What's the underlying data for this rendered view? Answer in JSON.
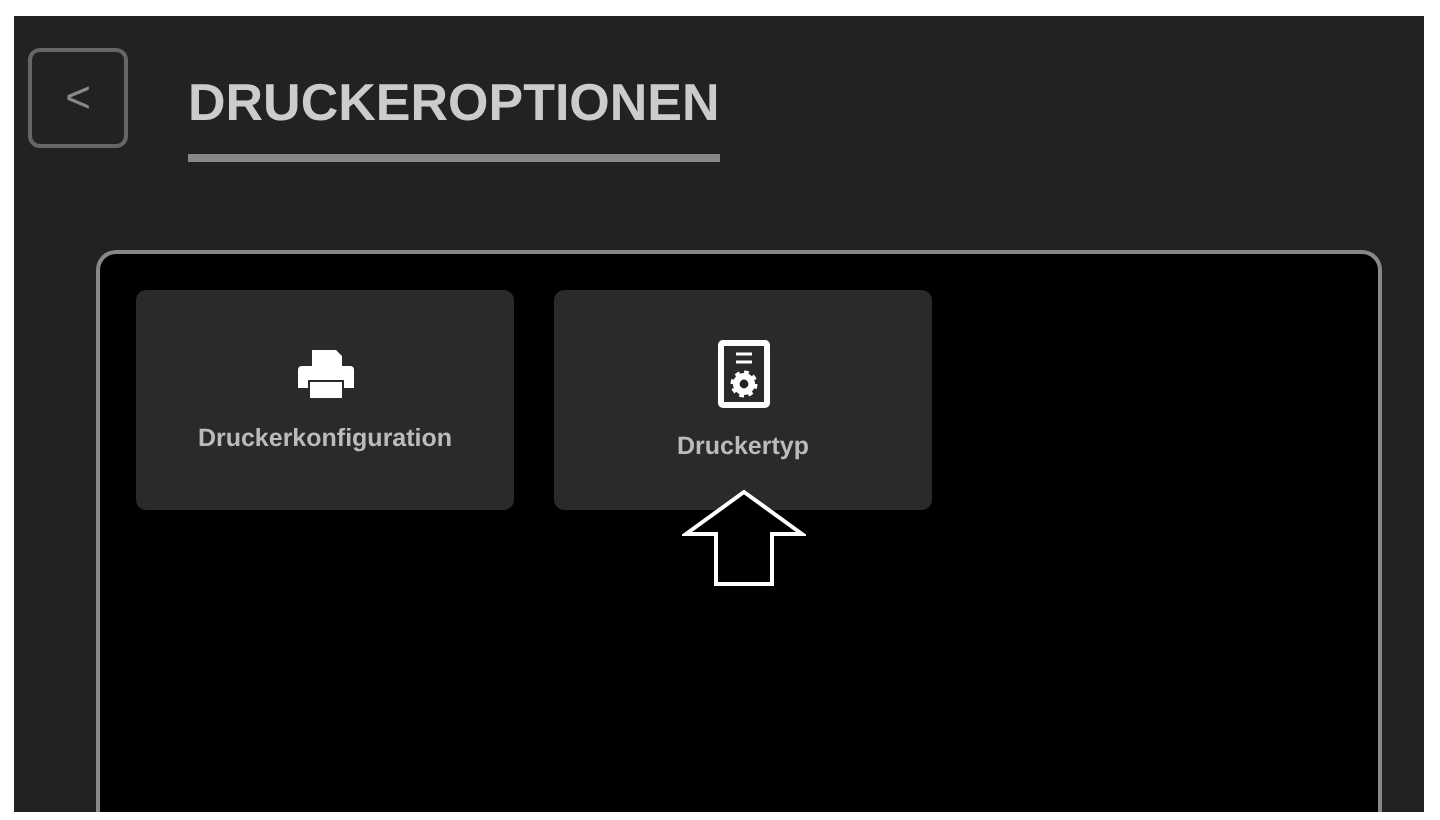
{
  "header": {
    "back_icon": "<",
    "title": "DRUCKEROPTIONEN"
  },
  "tiles": [
    {
      "kind": "printer",
      "label": "Druckerkonfiguration",
      "pointed": false
    },
    {
      "kind": "document",
      "label": "Druckertyp",
      "pointed": true
    }
  ]
}
